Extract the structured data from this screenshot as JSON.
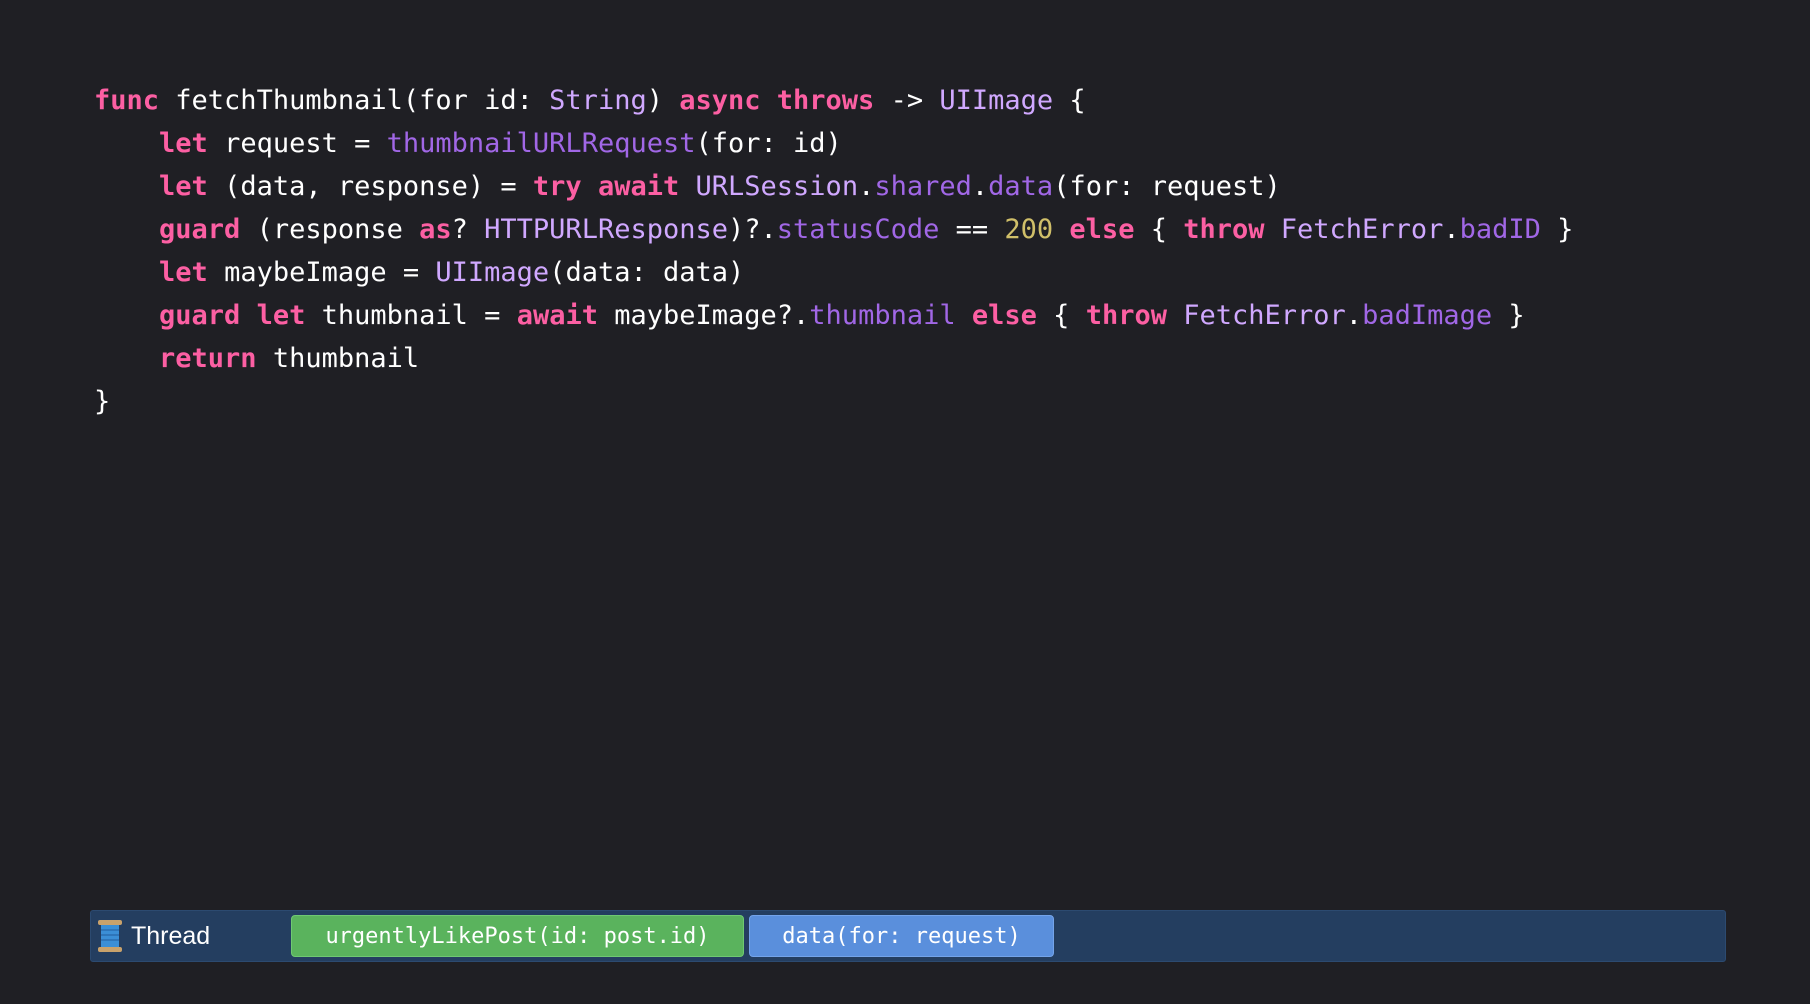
{
  "code": {
    "lines": [
      [
        {
          "t": "func",
          "c": "kw"
        },
        {
          "t": " fetchThumbnail(for id: ",
          "c": "pl"
        },
        {
          "t": "String",
          "c": "ty"
        },
        {
          "t": ") ",
          "c": "pl"
        },
        {
          "t": "async",
          "c": "kw"
        },
        {
          "t": " ",
          "c": "pl"
        },
        {
          "t": "throws",
          "c": "kw"
        },
        {
          "t": " -> ",
          "c": "pl"
        },
        {
          "t": "UIImage",
          "c": "ty"
        },
        {
          "t": " {",
          "c": "pl"
        }
      ],
      [
        {
          "t": "    ",
          "c": "pl"
        },
        {
          "t": "let",
          "c": "kw"
        },
        {
          "t": " request = ",
          "c": "pl"
        },
        {
          "t": "thumbnailURLRequest",
          "c": "fn"
        },
        {
          "t": "(for: id)",
          "c": "pl"
        }
      ],
      [
        {
          "t": "    ",
          "c": "pl"
        },
        {
          "t": "let",
          "c": "kw"
        },
        {
          "t": " (data, response) = ",
          "c": "pl"
        },
        {
          "t": "try",
          "c": "kw"
        },
        {
          "t": " ",
          "c": "pl"
        },
        {
          "t": "await",
          "c": "kw"
        },
        {
          "t": " ",
          "c": "pl"
        },
        {
          "t": "URLSession",
          "c": "ty"
        },
        {
          "t": ".",
          "c": "pl"
        },
        {
          "t": "shared",
          "c": "fn"
        },
        {
          "t": ".",
          "c": "pl"
        },
        {
          "t": "data",
          "c": "fn"
        },
        {
          "t": "(for: request)",
          "c": "pl"
        }
      ],
      [
        {
          "t": "    ",
          "c": "pl"
        },
        {
          "t": "guard",
          "c": "kw"
        },
        {
          "t": " (response ",
          "c": "pl"
        },
        {
          "t": "as",
          "c": "kw"
        },
        {
          "t": "? ",
          "c": "pl"
        },
        {
          "t": "HTTPURLResponse",
          "c": "ty"
        },
        {
          "t": ")?.",
          "c": "pl"
        },
        {
          "t": "statusCode",
          "c": "fn"
        },
        {
          "t": " == ",
          "c": "pl"
        },
        {
          "t": "200",
          "c": "nm"
        },
        {
          "t": " ",
          "c": "pl"
        },
        {
          "t": "else",
          "c": "kw"
        },
        {
          "t": " { ",
          "c": "pl"
        },
        {
          "t": "throw",
          "c": "kw"
        },
        {
          "t": " ",
          "c": "pl"
        },
        {
          "t": "FetchError",
          "c": "ty"
        },
        {
          "t": ".",
          "c": "pl"
        },
        {
          "t": "badID",
          "c": "fn"
        },
        {
          "t": " }",
          "c": "pl"
        }
      ],
      [
        {
          "t": "    ",
          "c": "pl"
        },
        {
          "t": "let",
          "c": "kw"
        },
        {
          "t": " maybeImage = ",
          "c": "pl"
        },
        {
          "t": "UIImage",
          "c": "ty"
        },
        {
          "t": "(data: data)",
          "c": "pl"
        }
      ],
      [
        {
          "t": "    ",
          "c": "pl"
        },
        {
          "t": "guard",
          "c": "kw"
        },
        {
          "t": " ",
          "c": "pl"
        },
        {
          "t": "let",
          "c": "kw"
        },
        {
          "t": " thumbnail = ",
          "c": "pl"
        },
        {
          "t": "await",
          "c": "kw"
        },
        {
          "t": " maybeImage?.",
          "c": "pl"
        },
        {
          "t": "thumbnail",
          "c": "fn"
        },
        {
          "t": " ",
          "c": "pl"
        },
        {
          "t": "else",
          "c": "kw"
        },
        {
          "t": " { ",
          "c": "pl"
        },
        {
          "t": "throw",
          "c": "kw"
        },
        {
          "t": " ",
          "c": "pl"
        },
        {
          "t": "FetchError",
          "c": "ty"
        },
        {
          "t": ".",
          "c": "pl"
        },
        {
          "t": "badImage",
          "c": "fn"
        },
        {
          "t": " }",
          "c": "pl"
        }
      ],
      [
        {
          "t": "    ",
          "c": "pl"
        },
        {
          "t": "return",
          "c": "kw"
        },
        {
          "t": " thumbnail",
          "c": "pl"
        }
      ],
      [
        {
          "t": "}",
          "c": "pl"
        }
      ]
    ]
  },
  "timeline": {
    "thread_icon": "spool-of-thread-icon",
    "thread_label": "Thread",
    "tasks": [
      {
        "label": "urgentlyLikePost(id: post.id)",
        "color": "#5ab35d"
      },
      {
        "label": "data(for: request)",
        "color": "#5a8fdc"
      }
    ]
  },
  "colors": {
    "background": "#1f1f24",
    "keyword": "#fc5fa3",
    "type": "#d0a8ff",
    "member": "#a167e6",
    "number": "#d0bf69",
    "plain": "#ffffff",
    "timeline_bar": "#243e60"
  }
}
